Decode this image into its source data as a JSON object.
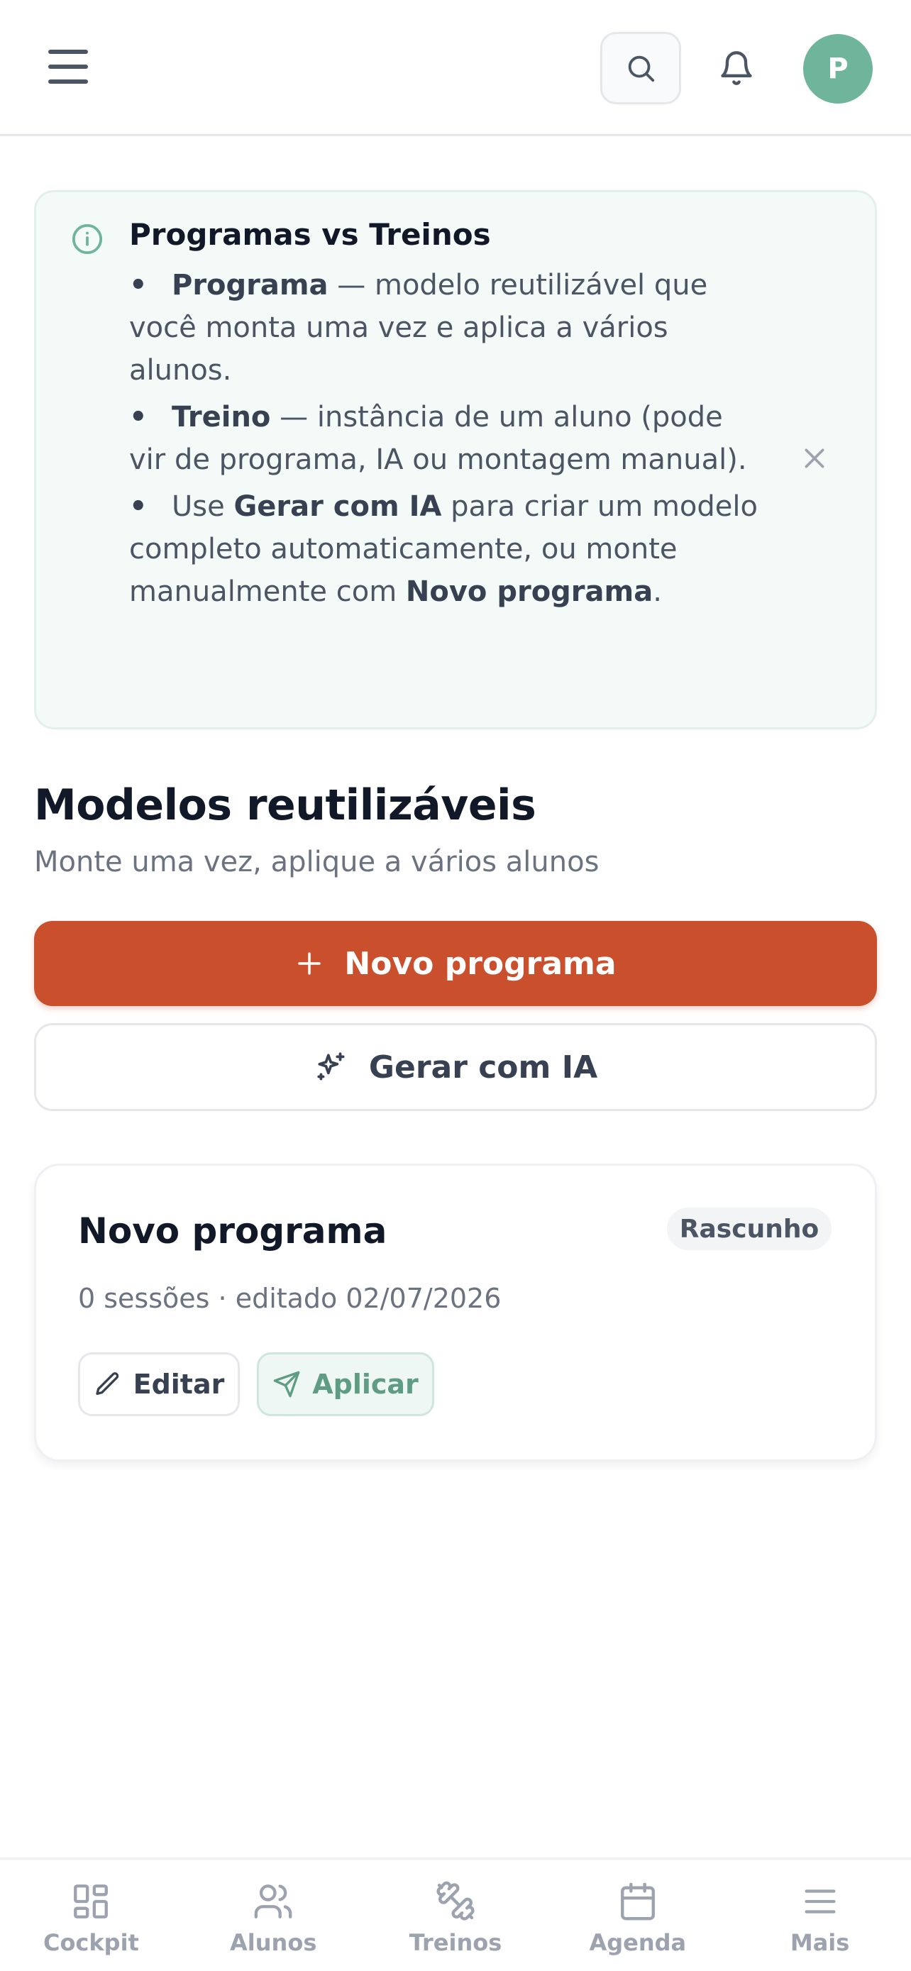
{
  "header": {
    "avatar_initial": "P"
  },
  "info": {
    "title": "Programas vs Treinos",
    "item1_bold": "Programa",
    "item1_text": " — modelo reutilizável que você monta uma vez e aplica a vários alunos.",
    "item2_bold": "Treino",
    "item2_text": " — instância de um aluno (pode vir de programa, IA ou montagem manual).",
    "item3_pre": "Use ",
    "item3_bold1": "Gerar com IA",
    "item3_mid": " para criar um modelo completo automaticamente, ou monte manualmente com ",
    "item3_bold2": "Novo programa",
    "item3_post": "."
  },
  "section": {
    "title": "Modelos reutilizáveis",
    "subtitle": "Monte uma vez, aplique a vários alunos",
    "new_program_label": "Novo programa",
    "ai_label": "Gerar com IA"
  },
  "program_card": {
    "title": "Novo programa",
    "status": "Rascunho",
    "meta": "0 sessões · editado 02/07/2026",
    "edit_label": "Editar",
    "apply_label": "Aplicar"
  },
  "nav": {
    "cockpit": "Cockpit",
    "alunos": "Alunos",
    "treinos": "Treinos",
    "agenda": "Agenda",
    "mais": "Mais"
  },
  "colors": {
    "primary": "#c94f2d",
    "accent_green": "#6fb59c",
    "text_dark": "#111827",
    "text_muted": "#6b7280"
  }
}
